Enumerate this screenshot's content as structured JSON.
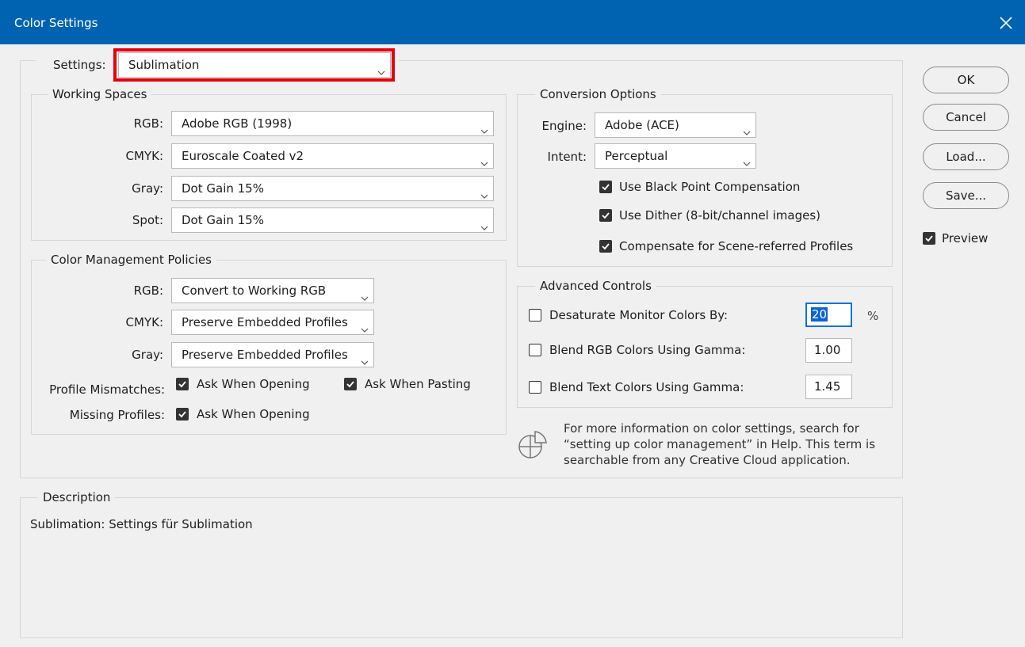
{
  "window": {
    "title": "Color Settings",
    "close_icon": "close-icon"
  },
  "settings": {
    "label": "Settings:",
    "value": "Sublimation",
    "highlight_color": "#e8000c"
  },
  "working_spaces": {
    "legend": "Working Spaces",
    "rgb": {
      "label": "RGB:",
      "value": "Adobe RGB (1998)"
    },
    "cmyk": {
      "label": "CMYK:",
      "value": "Euroscale Coated v2"
    },
    "gray": {
      "label": "Gray:",
      "value": "Dot Gain 15%"
    },
    "spot": {
      "label": "Spot:",
      "value": "Dot Gain 15%"
    }
  },
  "policies": {
    "legend": "Color Management Policies",
    "rgb": {
      "label": "RGB:",
      "value": "Convert to Working RGB"
    },
    "cmyk": {
      "label": "CMYK:",
      "value": "Preserve Embedded Profiles"
    },
    "gray": {
      "label": "Gray:",
      "value": "Preserve Embedded Profiles"
    },
    "profile_mismatches": {
      "label": "Profile Mismatches:",
      "ask_opening": {
        "label": "Ask When Opening",
        "checked": true
      },
      "ask_pasting": {
        "label": "Ask When Pasting",
        "checked": true
      }
    },
    "missing_profiles": {
      "label": "Missing Profiles:",
      "ask_opening": {
        "label": "Ask When Opening",
        "checked": true
      }
    }
  },
  "conversion": {
    "legend": "Conversion Options",
    "engine": {
      "label": "Engine:",
      "value": "Adobe (ACE)"
    },
    "intent": {
      "label": "Intent:",
      "value": "Perceptual"
    },
    "black_point": {
      "label": "Use Black Point Compensation",
      "checked": true
    },
    "dither": {
      "label": "Use Dither (8-bit/channel images)",
      "checked": true
    },
    "scene_referred": {
      "label": "Compensate for Scene-referred Profiles",
      "checked": true
    }
  },
  "advanced": {
    "legend": "Advanced Controls",
    "desaturate": {
      "label": "Desaturate Monitor Colors By:",
      "checked": false,
      "value": "20",
      "unit": "%"
    },
    "blend_rgb": {
      "label": "Blend RGB Colors Using Gamma:",
      "checked": false,
      "value": "1.00"
    },
    "blend_text": {
      "label": "Blend Text Colors Using Gamma:",
      "checked": false,
      "value": "1.45"
    }
  },
  "info": {
    "icon": "color-settings-info-icon",
    "text": "For more information on color settings, search for “setting up color management” in Help. This term is searchable from any Creative Cloud application."
  },
  "description": {
    "legend": "Description",
    "text": "Sublimation: Settings für Sublimation"
  },
  "buttons": {
    "ok": "OK",
    "cancel": "Cancel",
    "load": "Load...",
    "save": "Save..."
  },
  "preview": {
    "label": "Preview",
    "checked": true
  },
  "colors": {
    "titlebar": "#0063b1",
    "accent": "#1373d9"
  }
}
